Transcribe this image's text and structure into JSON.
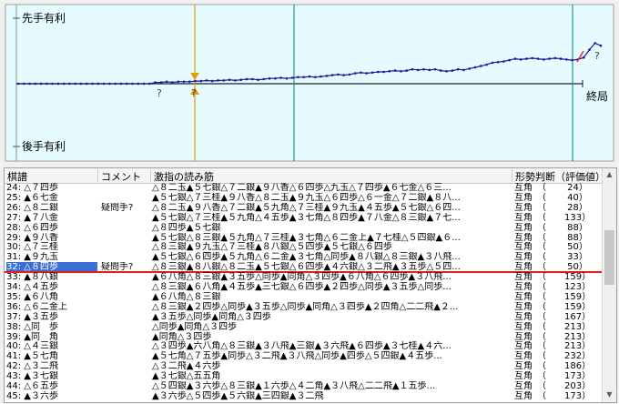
{
  "graph": {
    "label_top": "先手有利",
    "label_bottom": "後手有利",
    "label_end": "終局",
    "question_marks": [
      "?",
      "?",
      "?"
    ],
    "points": [
      0,
      0,
      0,
      0,
      0,
      0,
      0,
      0,
      0,
      0,
      0,
      0,
      0,
      0,
      0,
      0,
      0,
      0,
      0,
      0,
      0,
      0,
      0,
      0,
      0.02,
      0.02,
      0.03,
      0.02,
      0.03,
      0.03,
      0.03,
      0.04,
      0.04,
      0.05,
      0.04,
      0.05,
      0.05,
      0.06,
      0.05,
      0.06,
      0.07,
      0.07,
      0.06,
      0.07,
      0.08,
      0.08,
      0.09,
      0.08,
      0.09,
      0.1,
      0.1,
      0.11,
      0.1,
      0.11,
      0.12,
      0.13,
      0.14,
      0.13,
      0.14,
      0.16,
      0.17,
      0.16,
      0.17,
      0.18,
      0.18,
      0.19,
      0.2,
      0.19,
      0.2,
      0.22,
      0.21,
      0.22,
      0.21,
      0.22,
      0.2,
      0.19,
      0.2,
      0.22,
      0.21,
      0.23,
      0.25,
      0.27,
      0.29,
      0.32,
      0.33,
      0.34,
      0.36,
      0.38,
      0.37,
      0.38,
      0.39,
      0.38,
      0.37,
      0.38,
      0.39,
      0.38,
      0.37,
      0.36,
      0.37,
      0.4,
      0.52,
      0.62,
      0.58
    ],
    "colors": {
      "line": "#1a1aa0",
      "accent": "#008080",
      "cursor": "#e0a000",
      "mark": "#e03030"
    }
  },
  "table": {
    "headers": [
      "棋譜",
      "コメント",
      "激指の読み筋",
      "形勢判断（評価値）"
    ],
    "rows": [
      {
        "move": "24: △７四歩",
        "comment": "",
        "reading": "△８二玉▲５七銀△７二銀▲９八香△６四歩△九玉△７四歩▲６七金△６三...",
        "eval": "互角　（　　 24）"
      },
      {
        "move": "25: ▲６七金",
        "comment": "",
        "reading": "▲５七銀△７三桂▲９八香△８二玉▲９九玉△６四歩△６一金△７二銀▲８八...",
        "eval": "互角　（　　 40）"
      },
      {
        "move": "26: △８二銀",
        "comment": "疑問手?",
        "reading": "△８二玉▲９八香△７二銀▲５九角△７三桂▲９九玉▲４五歩▲５七銀△６四...",
        "eval": "互角　（　　 28）"
      },
      {
        "move": "27: ▲７八金",
        "comment": "",
        "reading": "▲５七銀△７三桂▲５九角△４五歩▲３七角△８四歩▲７八金△８三銀▲７七...",
        "eval": "互角　（　　133）"
      },
      {
        "move": "28: △６四歩",
        "comment": "",
        "reading": "△８四歩▲５七銀",
        "eval": "互角　（　　 88）"
      },
      {
        "move": "29: ▲９八香",
        "comment": "",
        "reading": "▲５七銀△８三銀▲５九角△７三桂▲３七角△６二金上▲７七桂△５四銀▲６...",
        "eval": "互角　（　　 88）"
      },
      {
        "move": "30: △７三桂",
        "comment": "",
        "reading": "△８三銀▲９九玉△７三桂▲８八銀△５四歩▲５七銀△６四歩",
        "eval": "互角　（　　 50）"
      },
      {
        "move": "31: ▲９九玉",
        "comment": "",
        "reading": "▲５七銀△６四歩▲５九角△６二金▲３七角△同歩▲８八銀△８三銀▲３八飛...",
        "eval": "互角　（　　 33）"
      },
      {
        "move": "32: △８四歩",
        "comment": "疑問手?",
        "reading": "△８三銀▲８八銀△８二玉▲５七銀△６四歩▲４六銀△３二飛▲３五歩△５四...",
        "eval": "互角　（　　 50）"
      },
      {
        "move": "33: ▲８八銀",
        "comment": "",
        "reading": "▲６八角△８三銀▲３五歩△同歩▲同角△３四歩▲６八角△６四歩▲３八飛...",
        "eval": "互角　（　　159）"
      },
      {
        "move": "34: △４五歩",
        "comment": "",
        "reading": "△８三銀▲６八角▲４五歩▲三七銀△６四歩▲２四歩△同歩▲３五歩△同歩...",
        "eval": "互角　（　　123）"
      },
      {
        "move": "35: ▲６八角",
        "comment": "",
        "reading": "▲６八角△８三銀",
        "eval": "互角　（　　159）"
      },
      {
        "move": "36: △６二金上",
        "comment": "",
        "reading": "△８三銀▲２四歩△同歩▲３五歩△同歩▲同角△３四歩▲２四角△二二飛▲２...",
        "eval": "互角　（　　159）"
      },
      {
        "move": "37: ▲３五歩",
        "comment": "",
        "reading": "▲３五歩△同歩▲同角△３四歩",
        "eval": "互角　（　　167）"
      },
      {
        "move": "38: △同　歩",
        "comment": "",
        "reading": "△同歩▲同角△３四歩",
        "eval": "互角　（　　213）"
      },
      {
        "move": "39: ▲同　角",
        "comment": "",
        "reading": "▲同角△３四歩",
        "eval": "互角　（　　213）"
      },
      {
        "move": "40: △４三銀",
        "comment": "",
        "reading": "△３四歩▲六八角△８三銀▲３八飛▲三銀▲３六飛▲６四歩▲３七桂▲４六...",
        "eval": "互角　（　　213）"
      },
      {
        "move": "41: ▲５七角",
        "comment": "",
        "reading": "▲５七角△７五歩▲同歩△３二飛▲３八飛△同歩▲四歩△５四銀▲４五歩...",
        "eval": "互角　（　　232）"
      },
      {
        "move": "42: △３二飛",
        "comment": "",
        "reading": "△３二飛▲４六歩",
        "eval": "互角　（　　186）"
      },
      {
        "move": "43: ▲３七銀",
        "comment": "",
        "reading": "▲３七銀△五五角",
        "eval": "互角　（　　173）"
      },
      {
        "move": "44: △６五歩",
        "comment": "",
        "reading": "△５四銀▲３六歩△８三銀▲１六歩△４二角▲３八飛△二二飛▲１五歩...",
        "eval": "互角　（　　203）"
      },
      {
        "move": "45: ▲３六歩",
        "comment": "",
        "reading": "▲３六歩△５四歩▲５六銀▲三四銀▲３二飛",
        "eval": "互角　（　　173）"
      }
    ]
  }
}
